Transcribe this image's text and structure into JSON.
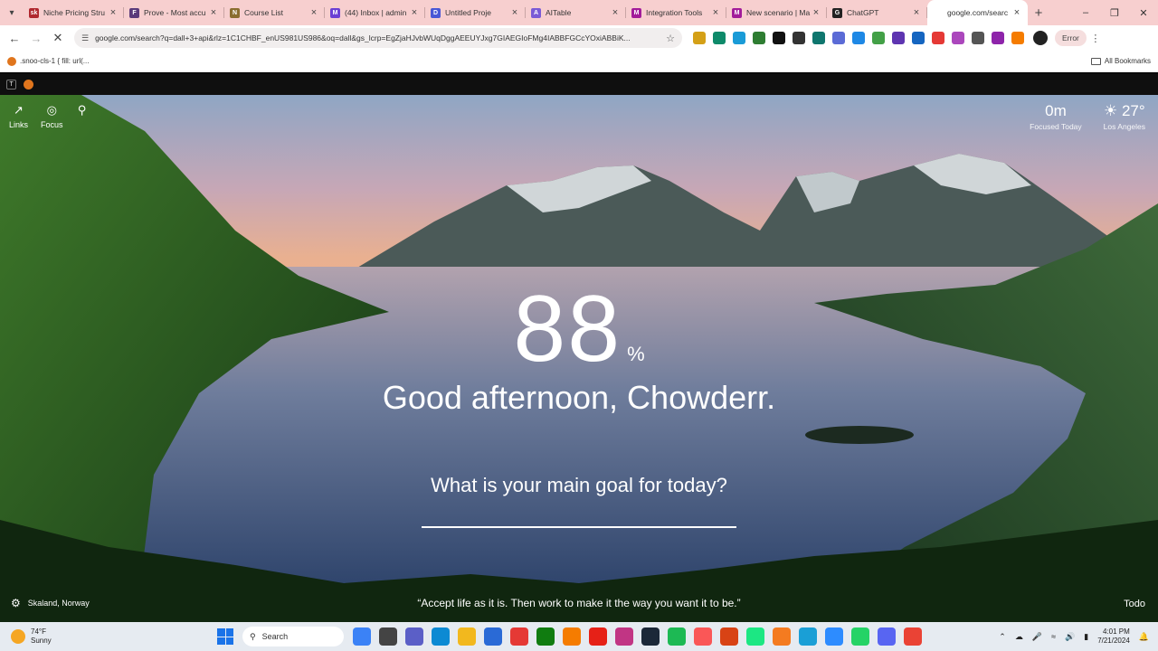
{
  "browser": {
    "tabs": [
      {
        "label": "Niche Pricing Stru",
        "fav": "sk",
        "color": "#b0282f"
      },
      {
        "label": "Prove - Most accu",
        "fav": "F",
        "color": "#5a3a7a"
      },
      {
        "label": "Course List",
        "fav": "N",
        "color": "#8a6d2f"
      },
      {
        "label": "(44) Inbox | admin",
        "fav": "M",
        "color": "#6b3fd4"
      },
      {
        "label": "Untitled Proje",
        "fav": "D",
        "color": "#4957d6"
      },
      {
        "label": "AITable",
        "fav": "A",
        "color": "#7a5ad6"
      },
      {
        "label": "Integration Tools",
        "fav": "M",
        "color": "#a21c9a"
      },
      {
        "label": "New scenario | Ma",
        "fav": "M",
        "color": "#a21c9a"
      },
      {
        "label": "ChatGPT",
        "fav": "G",
        "color": "#222222"
      },
      {
        "label": "google.com/searc",
        "fav": "",
        "color": "#ffffff",
        "active": true
      }
    ],
    "url": "google.com/search?q=dall+3+api&rlz=1C1CHBF_enUS981US986&oq=dall&gs_lcrp=EgZjaHJvbWUqDggAEEUYJxg7GIAEGIoFMg4IABBFGCcYOxiABBiK...",
    "profile_badge": "Error",
    "bookmarks": {
      "first": ".snoo-cls-1 { fill: url(...",
      "all": "All Bookmarks"
    }
  },
  "extensions": [
    {
      "name": "ext-1",
      "color": "#d4a017"
    },
    {
      "name": "ext-2",
      "color": "#0e8a6a"
    },
    {
      "name": "ext-3",
      "color": "#1a9bd7"
    },
    {
      "name": "ext-4",
      "color": "#2e7d32"
    },
    {
      "name": "ext-5",
      "color": "#111111"
    },
    {
      "name": "ext-6",
      "color": "#333333"
    },
    {
      "name": "ext-7",
      "color": "#0f766e"
    },
    {
      "name": "ext-8",
      "color": "#5b6bd6"
    },
    {
      "name": "ext-9",
      "color": "#1e88e5"
    },
    {
      "name": "ext-10",
      "color": "#43a047"
    },
    {
      "name": "ext-11",
      "color": "#5e35b1"
    },
    {
      "name": "ext-12",
      "color": "#1565c0"
    },
    {
      "name": "ext-13",
      "color": "#e53935"
    },
    {
      "name": "ext-14",
      "color": "#ab47bc"
    },
    {
      "name": "ext-15",
      "color": "#555555"
    },
    {
      "name": "ext-16",
      "color": "#8e24aa"
    },
    {
      "name": "ext-17",
      "color": "#f57c00"
    }
  ],
  "dashboard": {
    "links_label": "Links",
    "focus_label": "Focus",
    "focus_time": "0m",
    "focus_time_label": "Focused Today",
    "temperature": "27°",
    "weather_location": "Los Angeles",
    "clock_value": "88",
    "clock_suffix": "%",
    "greeting": "Good afternoon, Chowderr.",
    "goal_question": "What is your main goal for today?",
    "photo_location": "Skaland, Norway",
    "quote": "“Accept life as it is. Then work to make it the way you want it to be.”",
    "todo_label": "Todo"
  },
  "taskbar": {
    "weather_temp": "74°F",
    "weather_cond": "Sunny",
    "search_label": "Search",
    "apps": [
      {
        "name": "copilot",
        "color": "#3b82f6"
      },
      {
        "name": "task-view",
        "color": "#444444"
      },
      {
        "name": "teams",
        "color": "#5b5fc7"
      },
      {
        "name": "edge",
        "color": "#0c8ad3"
      },
      {
        "name": "explorer",
        "color": "#f2b81e"
      },
      {
        "name": "store",
        "color": "#2a6ad6"
      },
      {
        "name": "chrome",
        "color": "#e53935"
      },
      {
        "name": "xbox",
        "color": "#107c10"
      },
      {
        "name": "app-orange",
        "color": "#f57c00"
      },
      {
        "name": "youtube",
        "color": "#e62117"
      },
      {
        "name": "instagram",
        "color": "#c13584"
      },
      {
        "name": "steam",
        "color": "#1b2838"
      },
      {
        "name": "spotify",
        "color": "#1db954"
      },
      {
        "name": "itunes",
        "color": "#fa5757"
      },
      {
        "name": "app-red",
        "color": "#d84315"
      },
      {
        "name": "hulu",
        "color": "#1ce783"
      },
      {
        "name": "app-brush",
        "color": "#f47b20"
      },
      {
        "name": "app-active",
        "color": "#1a9fd6"
      },
      {
        "name": "zoom",
        "color": "#2d8cff"
      },
      {
        "name": "whatsapp",
        "color": "#25d366"
      },
      {
        "name": "discord",
        "color": "#5865f2"
      },
      {
        "name": "chrome-2",
        "color": "#ea4335"
      }
    ],
    "time": "4:01 PM",
    "date": "7/21/2024"
  }
}
